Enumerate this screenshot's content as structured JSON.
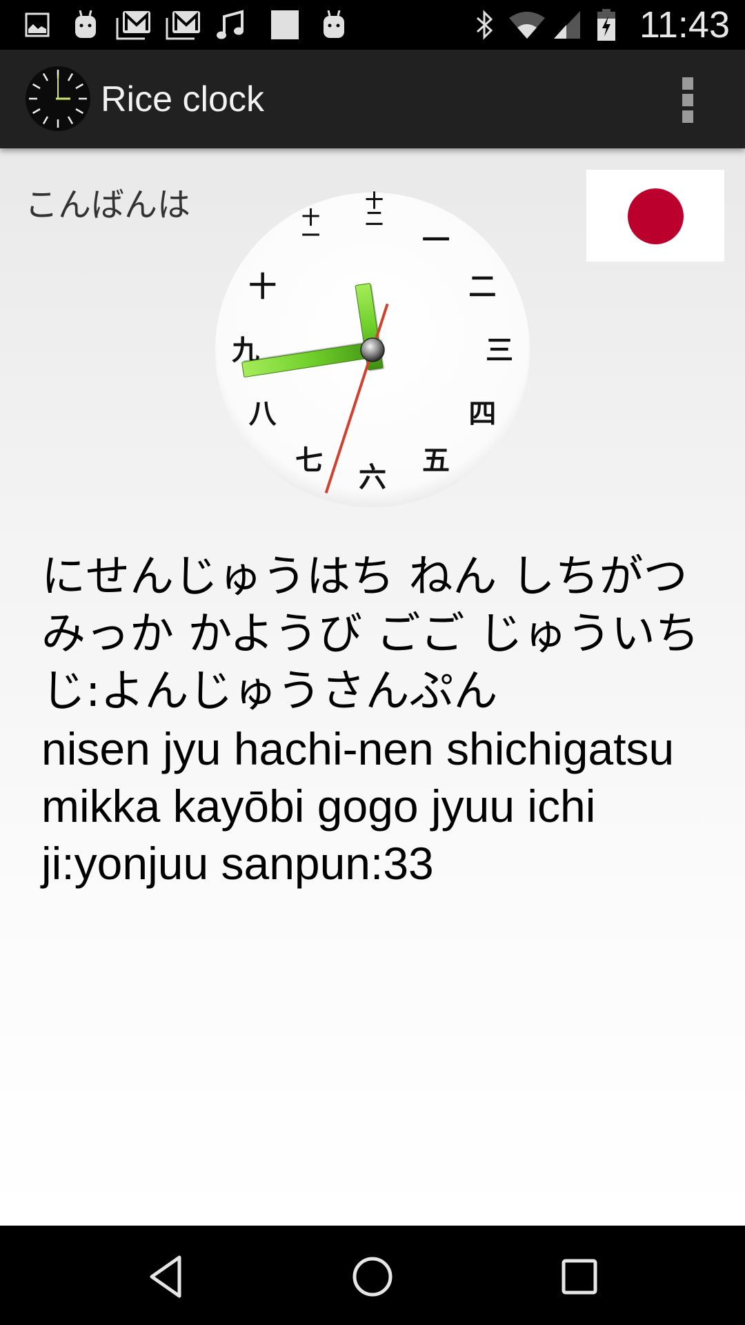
{
  "status_bar": {
    "notification_icons": [
      "image-icon",
      "android-icon",
      "gmail-icon",
      "gmail-icon",
      "music-icon",
      "blank-square-icon",
      "android-icon"
    ],
    "system_icons": [
      "bluetooth-icon",
      "wifi-icon",
      "cell-signal-icon",
      "battery-charging-icon"
    ],
    "time": "11:43"
  },
  "app_bar": {
    "app_icon": "clock-icon",
    "title": "Rice clock",
    "overflow_icon": "more-vert-icon"
  },
  "main": {
    "greeting": "こんばんは",
    "flag": {
      "country": "Japan",
      "background": "#ffffff",
      "sun_color": "#bc002d"
    },
    "clock": {
      "numerals": [
        "一",
        "二",
        "三",
        "四",
        "五",
        "六",
        "七",
        "八",
        "九",
        "十",
        "十一",
        "十二"
      ],
      "time": {
        "hour": 11,
        "minute": 43,
        "second": 33
      },
      "hand_color": "#7ed321",
      "second_hand_color": "#d0412f"
    },
    "readout": {
      "kana_line": "にせんじゅうはち ねん しちがつ みっか かようび ごご じゅういちじ:よんじゅうさんぷん",
      "romaji_line": "nisen jyu hachi-nen shichigatsu mikka kayōbi gogo jyuu ichi ji:yonjuu sanpun:33"
    }
  },
  "nav_bar": {
    "back_icon": "back-triangle-icon",
    "home_icon": "home-circle-icon",
    "recents_icon": "recents-square-icon"
  }
}
